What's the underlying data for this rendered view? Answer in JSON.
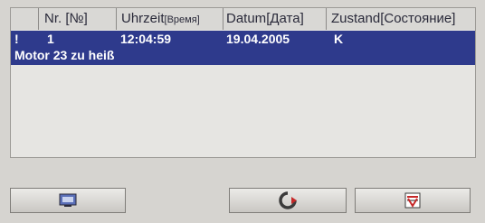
{
  "table": {
    "columns": [
      {
        "label": "Nr.",
        "ru": "[№]"
      },
      {
        "label": "Uhrzeit",
        "ru": "[Время]"
      },
      {
        "label": "Datum",
        "ru": "[Дата]"
      },
      {
        "label": "Zustand",
        "ru": "[Состояние]"
      }
    ],
    "rows": [
      {
        "flag": "!",
        "nr": "1",
        "time": "12:04:59",
        "date": "19.04.2005",
        "state": "K",
        "message": "Motor 23 zu heiß"
      }
    ]
  },
  "colors": {
    "selection": "#2e3a8c",
    "panel": "#e6e5e2",
    "background": "#d6d4d0"
  },
  "buttons": [
    {
      "icon": "monitor-icon"
    },
    {
      "icon": "acknowledge-icon"
    },
    {
      "icon": "filter-icon"
    }
  ]
}
